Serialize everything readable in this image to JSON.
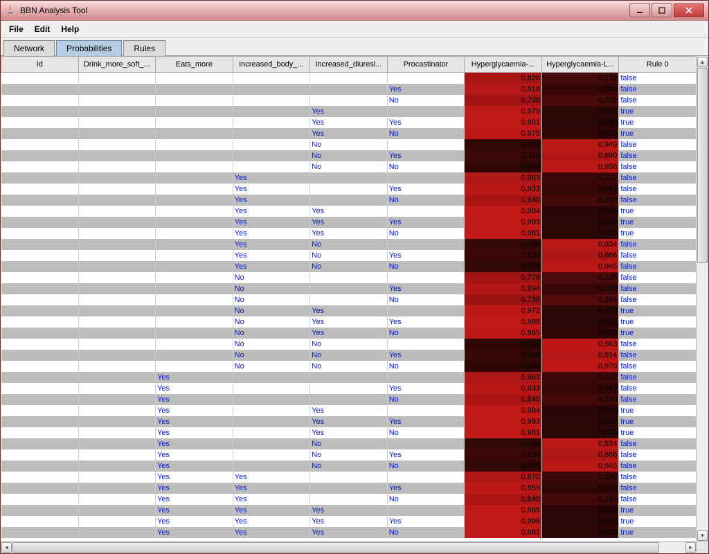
{
  "window": {
    "title": "BBN Analysis Tool"
  },
  "menu": {
    "file": "File",
    "edit": "Edit",
    "help": "Help"
  },
  "tabs": {
    "network": "Network",
    "probabilities": "Probabilities",
    "rules": "Rules",
    "active": "probabilities"
  },
  "columns": [
    "Id",
    "Drink_more_soft_...",
    "Eats_more",
    "Increased_body_...",
    "Increased_diuresi...",
    "Procastinator",
    "Hyperglycaemia-...",
    "Hyperglycaemia-L...",
    "Rule 0"
  ],
  "rows": [
    {
      "c": [
        "",
        "",
        "",
        "",
        "",
        "",
        "0,828",
        "0,172",
        "false"
      ],
      "h": [
        0.828,
        0.172
      ]
    },
    {
      "c": [
        "",
        "",
        "",
        "",
        "",
        "Yes",
        "0,918",
        "0,082",
        "false"
      ],
      "h": [
        0.918,
        0.082
      ]
    },
    {
      "c": [
        "",
        "",
        "",
        "",
        "",
        "No",
        "0,798",
        "0,202",
        "false"
      ],
      "h": [
        0.798,
        0.202
      ]
    },
    {
      "c": [
        "",
        "",
        "",
        "",
        "Yes",
        "",
        "0,979",
        "0,021",
        "true"
      ],
      "h": [
        0.979,
        0.021
      ]
    },
    {
      "c": [
        "",
        "",
        "",
        "",
        "Yes",
        "Yes",
        "0,991",
        "0,009",
        "true"
      ],
      "h": [
        0.991,
        0.009
      ]
    },
    {
      "c": [
        "",
        "",
        "",
        "",
        "Yes",
        "No",
        "0,975",
        "0,025",
        "true"
      ],
      "h": [
        0.975,
        0.025
      ]
    },
    {
      "c": [
        "",
        "",
        "",
        "",
        "No",
        "",
        "0,051",
        "0,949",
        "false"
      ],
      "h": [
        0.051,
        0.949
      ]
    },
    {
      "c": [
        "",
        "",
        "",
        "",
        "No",
        "Yes",
        "0,110",
        "0,890",
        "false"
      ],
      "h": [
        0.11,
        0.89
      ]
    },
    {
      "c": [
        "",
        "",
        "",
        "",
        "No",
        "No",
        "0,042",
        "0,958",
        "false"
      ],
      "h": [
        0.042,
        0.958
      ]
    },
    {
      "c": [
        "",
        "",
        "",
        "Yes",
        "",
        "",
        "0,863",
        "0,137",
        "false"
      ],
      "h": [
        0.863,
        0.137
      ]
    },
    {
      "c": [
        "",
        "",
        "",
        "Yes",
        "",
        "Yes",
        "0,933",
        "0,067",
        "false"
      ],
      "h": [
        0.933,
        0.067
      ]
    },
    {
      "c": [
        "",
        "",
        "",
        "Yes",
        "",
        "No",
        "0,840",
        "0,160",
        "false"
      ],
      "h": [
        0.84,
        0.16
      ]
    },
    {
      "c": [
        "",
        "",
        "",
        "Yes",
        "Yes",
        "",
        "0,984",
        "0,016",
        "true"
      ],
      "h": [
        0.984,
        0.016
      ]
    },
    {
      "c": [
        "",
        "",
        "",
        "Yes",
        "Yes",
        "Yes",
        "0,993",
        "0,007",
        "true"
      ],
      "h": [
        0.993,
        0.007
      ]
    },
    {
      "c": [
        "",
        "",
        "",
        "Yes",
        "Yes",
        "No",
        "0,981",
        "0,019",
        "true"
      ],
      "h": [
        0.981,
        0.019
      ]
    },
    {
      "c": [
        "",
        "",
        "",
        "Yes",
        "No",
        "",
        "0,066",
        "0,934",
        "false"
      ],
      "h": [
        0.066,
        0.934
      ]
    },
    {
      "c": [
        "",
        "",
        "",
        "Yes",
        "No",
        "Yes",
        "0,134",
        "0,866",
        "false"
      ],
      "h": [
        0.134,
        0.866
      ]
    },
    {
      "c": [
        "",
        "",
        "",
        "Yes",
        "No",
        "No",
        "0,055",
        "0,945",
        "false"
      ],
      "h": [
        0.055,
        0.945
      ]
    },
    {
      "c": [
        "",
        "",
        "",
        "No",
        "",
        "",
        "0,776",
        "0,225",
        "false"
      ],
      "h": [
        0.776,
        0.225
      ]
    },
    {
      "c": [
        "",
        "",
        "",
        "No",
        "",
        "Yes",
        "0,894",
        "0,106",
        "false"
      ],
      "h": [
        0.894,
        0.106
      ]
    },
    {
      "c": [
        "",
        "",
        "",
        "No",
        "",
        "No",
        "0,736",
        "0,264",
        "false"
      ],
      "h": [
        0.736,
        0.264
      ]
    },
    {
      "c": [
        "",
        "",
        "",
        "No",
        "Yes",
        "",
        "0,972",
        "0,028",
        "true"
      ],
      "h": [
        0.972,
        0.028
      ]
    },
    {
      "c": [
        "",
        "",
        "",
        "No",
        "Yes",
        "Yes",
        "0,988",
        "0,012",
        "true"
      ],
      "h": [
        0.988,
        0.012
      ]
    },
    {
      "c": [
        "",
        "",
        "",
        "No",
        "Yes",
        "No",
        "0,965",
        "0,035",
        "true"
      ],
      "h": [
        0.965,
        0.035
      ]
    },
    {
      "c": [
        "",
        "",
        "",
        "No",
        "No",
        "",
        "0,037",
        "0,963",
        "false"
      ],
      "h": [
        0.037,
        0.963
      ]
    },
    {
      "c": [
        "",
        "",
        "",
        "No",
        "No",
        "Yes",
        "0,086",
        "0,914",
        "false"
      ],
      "h": [
        0.086,
        0.914
      ]
    },
    {
      "c": [
        "",
        "",
        "",
        "No",
        "No",
        "No",
        "0,030",
        "0,970",
        "false"
      ],
      "h": [
        0.03,
        0.97
      ]
    },
    {
      "c": [
        "",
        "",
        "Yes",
        "",
        "",
        "",
        "0,863",
        "0,137",
        "false"
      ],
      "h": [
        0.863,
        0.137
      ]
    },
    {
      "c": [
        "",
        "",
        "Yes",
        "",
        "",
        "Yes",
        "0,933",
        "0,067",
        "false"
      ],
      "h": [
        0.933,
        0.067
      ]
    },
    {
      "c": [
        "",
        "",
        "Yes",
        "",
        "",
        "No",
        "0,840",
        "0,160",
        "false"
      ],
      "h": [
        0.84,
        0.16
      ]
    },
    {
      "c": [
        "",
        "",
        "Yes",
        "",
        "Yes",
        "",
        "0,984",
        "0,016",
        "true"
      ],
      "h": [
        0.984,
        0.016
      ]
    },
    {
      "c": [
        "",
        "",
        "Yes",
        "",
        "Yes",
        "Yes",
        "0,993",
        "0,007",
        "true"
      ],
      "h": [
        0.993,
        0.007
      ]
    },
    {
      "c": [
        "",
        "",
        "Yes",
        "",
        "Yes",
        "No",
        "0,981",
        "0,019",
        "true"
      ],
      "h": [
        0.981,
        0.019
      ]
    },
    {
      "c": [
        "",
        "",
        "Yes",
        "",
        "No",
        "",
        "0,066",
        "0,934",
        "false"
      ],
      "h": [
        0.066,
        0.934
      ]
    },
    {
      "c": [
        "",
        "",
        "Yes",
        "",
        "No",
        "Yes",
        "0,134",
        "0,866",
        "false"
      ],
      "h": [
        0.134,
        0.866
      ]
    },
    {
      "c": [
        "",
        "",
        "Yes",
        "",
        "No",
        "No",
        "0,055",
        "0,945",
        "false"
      ],
      "h": [
        0.055,
        0.945
      ]
    },
    {
      "c": [
        "",
        "",
        "Yes",
        "Yes",
        "",
        "",
        "0,870",
        "0,130",
        "false"
      ],
      "h": [
        0.87,
        0.13
      ]
    },
    {
      "c": [
        "",
        "",
        "Yes",
        "Yes",
        "",
        "Yes",
        "0,959",
        "0,041",
        "false"
      ],
      "h": [
        0.959,
        0.041
      ]
    },
    {
      "c": [
        "",
        "",
        "Yes",
        "Yes",
        "",
        "No",
        "0,840",
        "0,160",
        "false"
      ],
      "h": [
        0.84,
        0.16
      ]
    },
    {
      "c": [
        "",
        "",
        "Yes",
        "Yes",
        "Yes",
        "",
        "0,985",
        "0,015",
        "true"
      ],
      "h": [
        0.985,
        0.015
      ]
    },
    {
      "c": [
        "",
        "",
        "Yes",
        "Yes",
        "Yes",
        "Yes",
        "0,996",
        "0,004",
        "true"
      ],
      "h": [
        0.996,
        0.004
      ]
    },
    {
      "c": [
        "",
        "",
        "Yes",
        "Yes",
        "Yes",
        "No",
        "0,981",
        "0,019",
        "true"
      ],
      "h": [
        0.981,
        0.019
      ]
    }
  ]
}
